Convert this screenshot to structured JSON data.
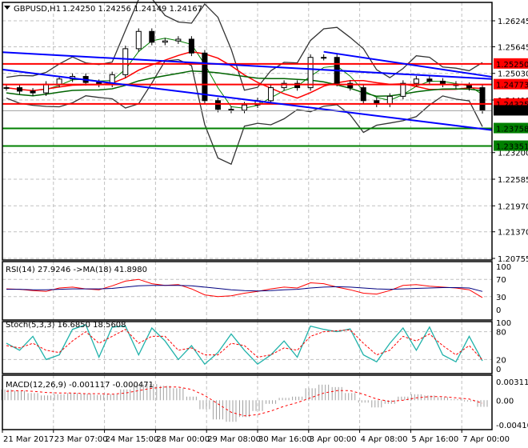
{
  "header": {
    "symbol": "GBPUSD,H1",
    "ohlc": "1.24250 1.24256 1.24149 1.24167",
    "menu_icon": "triangle-down-icon"
  },
  "colors": {
    "resistance": "#ff0000",
    "support": "#008000",
    "trendline": "#0000ff",
    "ma_fast": "#008000",
    "ma_slow": "#ff0000",
    "bands": "#333333",
    "rsi": "#ff0000",
    "rsi_ma": "#000080",
    "stoch_main": "#20b2aa",
    "stoch_signal": "#ff0000",
    "macd_hist": "#a0a0a0",
    "macd_signal": "#ff0000",
    "current_price": "#000000"
  },
  "chart_data": [
    {
      "type": "candlestick",
      "title": "GBPUSD,H1",
      "price_ticks": [
        "1.26245",
        "1.25645",
        "1.25030",
        "1.24415",
        "1.23200",
        "1.22585",
        "1.21970",
        "1.21370",
        "1.20755"
      ],
      "ylim": [
        1.20755,
        1.26245
      ],
      "grid": true,
      "time_labels": [
        "21 Mar 2017",
        "23 Mar 07:00",
        "24 Mar 15:00",
        "28 Mar 00:00",
        "29 Mar 08:00",
        "30 Mar 16:00",
        "3 Apr 00:00",
        "4 Apr 08:00",
        "5 Apr 16:00",
        "7 Apr 00:00"
      ],
      "close": [
        1.247,
        1.2462,
        1.2458,
        1.2478,
        1.249,
        1.2496,
        1.2482,
        1.2478,
        1.25,
        1.256,
        1.26,
        1.2575,
        1.2578,
        1.2582,
        1.255,
        1.244,
        1.242,
        1.2418,
        1.243,
        1.244,
        1.247,
        1.248,
        1.247,
        1.254,
        1.254,
        1.248,
        1.247,
        1.244,
        1.2432,
        1.245,
        1.248,
        1.249,
        1.2485,
        1.2478,
        1.2475,
        1.247,
        1.2417
      ],
      "levels": [
        {
          "label": "1.25250",
          "price": 1.2525,
          "kind": "resistance"
        },
        {
          "label": "1.24773",
          "price": 1.24773,
          "kind": "resistance"
        },
        {
          "label": "1.24325",
          "price": 1.24325,
          "kind": "resistance"
        },
        {
          "label": "1.23758",
          "price": 1.23758,
          "kind": "support"
        },
        {
          "label": "1.23351",
          "price": 1.23351,
          "kind": "support"
        }
      ],
      "current_price": {
        "label": "1.24167",
        "price": 1.24167
      },
      "trendlines": [
        {
          "from_bar": 0,
          "from_price": 1.2552,
          "to_bar": 37,
          "to_price": 1.249
        },
        {
          "from_bar": 0,
          "from_price": 1.2512,
          "to_bar": 37,
          "to_price": 1.2372
        },
        {
          "from_bar": 24,
          "from_price": 1.2553,
          "to_bar": 37,
          "to_price": 1.2495
        }
      ]
    },
    {
      "type": "line",
      "title": "RSI(14) 27.9246  ->MA(18) 41.8980",
      "ylim": [
        0,
        100
      ],
      "ticks": [
        "100",
        "70",
        "30",
        "0"
      ],
      "rsi": [
        48,
        47,
        44,
        42,
        50,
        52,
        48,
        46,
        55,
        66,
        70,
        60,
        56,
        58,
        48,
        34,
        30,
        32,
        38,
        42,
        48,
        52,
        50,
        62,
        60,
        52,
        46,
        38,
        36,
        44,
        56,
        58,
        54,
        52,
        50,
        46,
        28
      ],
      "rsi_ma": [
        47,
        47,
        46,
        46,
        47,
        48,
        48,
        48,
        49,
        52,
        55,
        56,
        56,
        56,
        55,
        52,
        49,
        46,
        44,
        43,
        44,
        46,
        47,
        50,
        52,
        53,
        52,
        50,
        48,
        47,
        48,
        49,
        50,
        51,
        51,
        50,
        42
      ]
    },
    {
      "type": "line",
      "title": "Stoch(5,3,3) 16.6850 18.5608",
      "ylim": [
        0,
        100
      ],
      "ticks": [
        "100",
        "80",
        "20",
        "0"
      ],
      "main": [
        55,
        40,
        70,
        20,
        30,
        85,
        95,
        25,
        90,
        92,
        30,
        88,
        60,
        20,
        50,
        10,
        35,
        75,
        40,
        10,
        30,
        60,
        25,
        92,
        85,
        80,
        86,
        30,
        15,
        55,
        88,
        40,
        90,
        30,
        15,
        70,
        17
      ],
      "signal": [
        50,
        45,
        55,
        40,
        35,
        60,
        80,
        55,
        70,
        85,
        55,
        70,
        70,
        40,
        45,
        30,
        30,
        55,
        50,
        25,
        30,
        45,
        40,
        70,
        80,
        82,
        84,
        55,
        30,
        40,
        70,
        60,
        75,
        50,
        30,
        50,
        19
      ]
    },
    {
      "type": "bar",
      "title": "MACD(12,26,9) -0.001117 -0.000471",
      "ticks": [
        "0.003111",
        "0.00",
        "-0.004101"
      ],
      "ylim": [
        -0.004101,
        0.003111
      ],
      "histogram": [
        0.0018,
        0.0016,
        0.0012,
        0.0008,
        0.001,
        0.0012,
        0.0011,
        0.0009,
        0.001,
        0.0018,
        0.0026,
        0.0027,
        0.0024,
        0.002,
        0.0006,
        -0.0015,
        -0.0032,
        -0.0036,
        -0.0028,
        -0.0018,
        -0.0006,
        0.0004,
        0.0006,
        0.002,
        0.0026,
        0.0022,
        0.0012,
        -0.0004,
        -0.0012,
        -0.0006,
        0.0006,
        0.001,
        0.0008,
        0.0005,
        0.0002,
        -0.0002,
        -0.0011
      ],
      "signal": [
        0.0015,
        0.0016,
        0.0015,
        0.0013,
        0.0012,
        0.0012,
        0.0011,
        0.0011,
        0.001,
        0.0012,
        0.0016,
        0.002,
        0.0022,
        0.0022,
        0.0018,
        0.0008,
        -0.0006,
        -0.002,
        -0.0026,
        -0.0024,
        -0.0018,
        -0.001,
        -0.0004,
        0.0004,
        0.0012,
        0.0016,
        0.0016,
        0.001,
        0.0002,
        -0.0002,
        0.0,
        0.0004,
        0.0006,
        0.0006,
        0.0004,
        0.0002,
        -0.0005
      ]
    }
  ]
}
